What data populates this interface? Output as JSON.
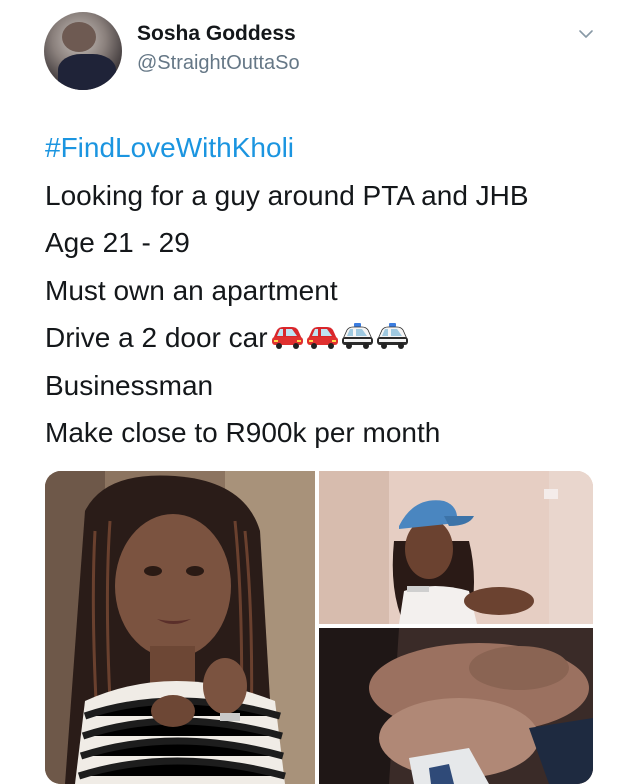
{
  "user": {
    "name": "Sosha Goddess",
    "handle": "@StraightOuttaSo"
  },
  "tweet": {
    "hashtag": "#FindLoveWithKholi",
    "lines": [
      "Looking for a guy around PTA and JHB",
      "Age 21 - 29",
      "Must own an apartment",
      "Drive a 2 door car",
      "Businessman",
      "Make close to R900k per month"
    ],
    "emoji": [
      "red-car",
      "red-car",
      "police-car",
      "police-car"
    ]
  },
  "colors": {
    "hashtag": "#1b95e0",
    "text": "#14171a",
    "secondary": "#657786"
  },
  "icons": {
    "menu": "chevron-down-icon"
  }
}
